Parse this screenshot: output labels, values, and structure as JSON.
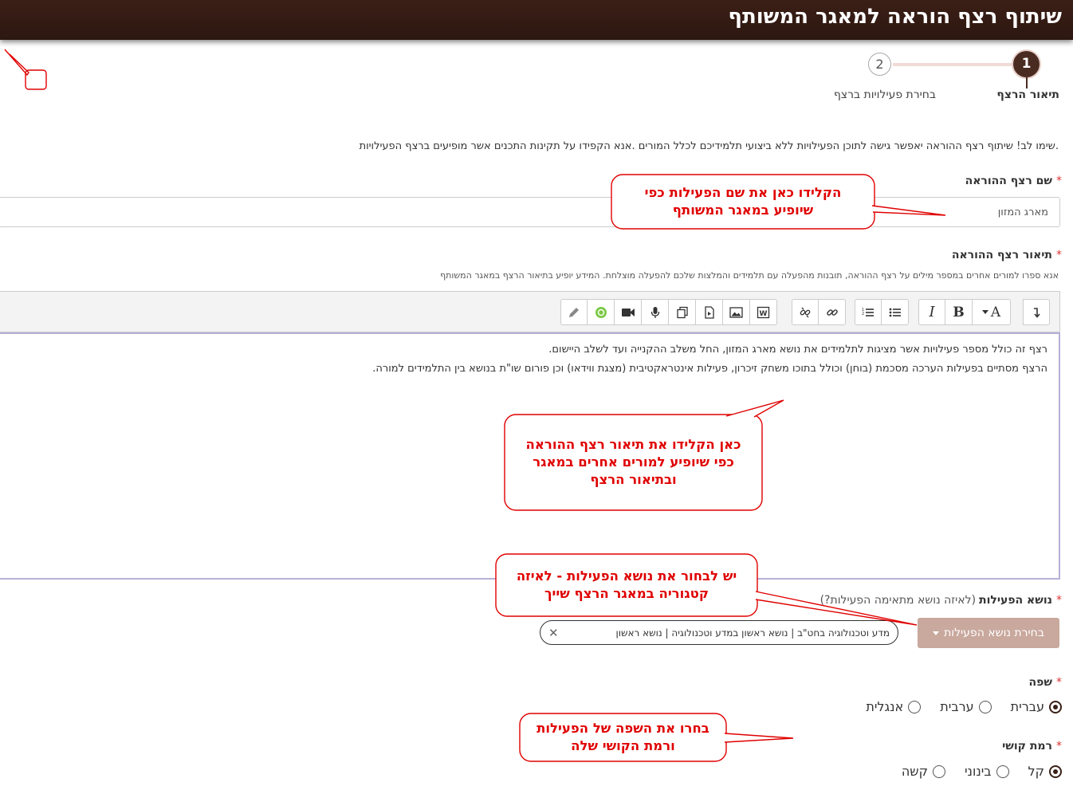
{
  "header": {
    "title": "שיתוף רצף הוראה למאגר המשותף"
  },
  "wizard": {
    "steps": [
      {
        "num": "1",
        "label": "תיאור הרצף"
      },
      {
        "num": "2",
        "label": "בחירת פעילויות ברצף"
      }
    ]
  },
  "warning": ".שימו לב! שיתוף רצף ההוראה יאפשר גישה לתוכן הפעילויות ללא ביצועי תלמידיכם לכלל המורים .אנא הקפידו על תקינות התכנים אשר מופיעים ברצף הפעילויות",
  "required_mark": "*",
  "name_field": {
    "label": "שם רצף ההוראה",
    "value": "מארג המזון"
  },
  "description_field": {
    "label": "תיאור רצף ההוראה",
    "hint": "אנא ספרו למורים אחרים במספר מילים על רצף ההוראה, תובנות מהפעלה עם תלמידים והמלצות שלכם להפעלה מוצלחת. המידע יופיע בתיאור הרצף במאגר המשותף",
    "lines": [
      "רצף זה כולל מספר פעילויות אשר מציגות לתלמידים את נושא מארג המזון, החל משלב ההקנייה ועד לשלב היישום.",
      "הרצף מסתיים בפעילות הערכה מסכמת (בוחן) וכולל בתוכו משחק זיכרון, פעילות אינטראקטיבית (מצגת ווידאו) וכן פורום שו\"ת בנושא בין התלמידים למורה."
    ]
  },
  "toolbar": {
    "bold": "B",
    "italic": "I",
    "font": "A"
  },
  "topic_field": {
    "label": "נושא הפעילות",
    "sub": "(לאיזה נושא מתאימה הפעילות?)",
    "button": "בחירת נושא הפעילות",
    "tag": "מדע וטכנולוגיה בחט\"ב | נושא ראשון במדע וטכנולוגיה | נושא ראשון",
    "tag_remove": "✕"
  },
  "language_field": {
    "label": "שפה",
    "options": [
      "עברית",
      "ערבית",
      "אנגלית"
    ],
    "selected": "עברית"
  },
  "difficulty_field": {
    "label": "רמת קושי",
    "options": [
      "קל",
      "בינוני",
      "קשה"
    ],
    "selected": "קל"
  },
  "callouts": {
    "name": [
      "הקלידו כאן את שם הפעילות כפי",
      "שיופיע במאגר המשותף"
    ],
    "description": [
      "כאן הקלידו את תיאור רצף ההוראה",
      "כפי שיופיע למורים אחרים במאגר",
      "ובתיאור הרצף"
    ],
    "topic": [
      "יש לבחור את נושא הפעילות - לאיזה",
      "קטגוריה במאגר הרצף שייך"
    ],
    "language": [
      "בחרו את השפה של הפעילות",
      "ורמת הקושי שלה"
    ]
  },
  "colors": {
    "header": "#2c1711",
    "accent": "#4a2b22",
    "topic_button": "#c9a89d",
    "callout": "#e00000"
  }
}
